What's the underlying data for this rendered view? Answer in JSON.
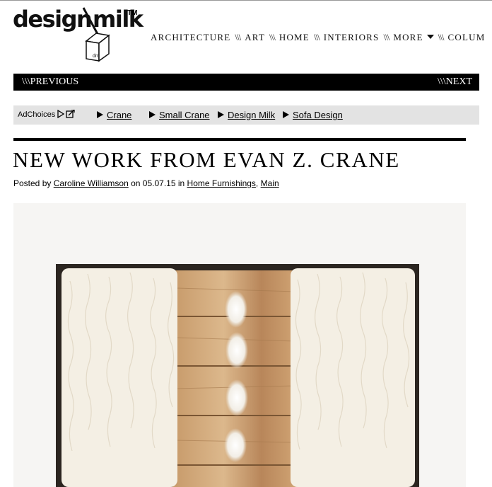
{
  "logo": {
    "word_left": "design",
    "word_right": "milk",
    "trademark": "TM",
    "carton_text": "dm"
  },
  "nav": {
    "items": [
      "ARCHITECTURE",
      "ART",
      "HOME",
      "INTERIORS",
      "MORE",
      "COLUM"
    ],
    "separator": "\\\\\\",
    "more_icon": "caret-down-icon"
  },
  "pager": {
    "previous": "\\\\\\PREVIOUS",
    "next": "\\\\\\NEXT"
  },
  "ads": {
    "adchoices": "AdChoices",
    "adchoices_icon": "adchoices-icon",
    "links": [
      "Crane",
      "Small Crane",
      "Design Milk",
      "Sofa Design"
    ],
    "link_icon": "play-triangle-icon"
  },
  "article": {
    "title": "NEW WORK FROM EVAN Z. CRANE",
    "posted_by_prefix": "Posted by",
    "author": "Caroline Williamson",
    "on_text": "on",
    "date": "05.07.15",
    "in_text": "in",
    "category_1": "Home Furnishings",
    "category_sep": ",",
    "category_2": "Main",
    "image_subject": "wooden dresser with white shaggy fur panels"
  },
  "colors": {
    "bar_black": "#000000",
    "ad_bar_gray": "#e3e3e3",
    "link_text": "#000000"
  }
}
